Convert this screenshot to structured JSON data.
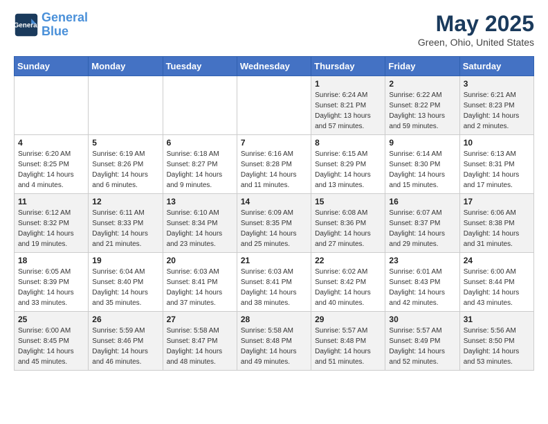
{
  "header": {
    "logo_line1": "General",
    "logo_line2": "Blue",
    "main_title": "May 2025",
    "subtitle": "Green, Ohio, United States"
  },
  "days_of_week": [
    "Sunday",
    "Monday",
    "Tuesday",
    "Wednesday",
    "Thursday",
    "Friday",
    "Saturday"
  ],
  "weeks": [
    [
      {
        "num": "",
        "sunrise": "",
        "sunset": "",
        "daylight": ""
      },
      {
        "num": "",
        "sunrise": "",
        "sunset": "",
        "daylight": ""
      },
      {
        "num": "",
        "sunrise": "",
        "sunset": "",
        "daylight": ""
      },
      {
        "num": "",
        "sunrise": "",
        "sunset": "",
        "daylight": ""
      },
      {
        "num": "1",
        "sunrise": "Sunrise: 6:24 AM",
        "sunset": "Sunset: 8:21 PM",
        "daylight": "Daylight: 13 hours and 57 minutes."
      },
      {
        "num": "2",
        "sunrise": "Sunrise: 6:22 AM",
        "sunset": "Sunset: 8:22 PM",
        "daylight": "Daylight: 13 hours and 59 minutes."
      },
      {
        "num": "3",
        "sunrise": "Sunrise: 6:21 AM",
        "sunset": "Sunset: 8:23 PM",
        "daylight": "Daylight: 14 hours and 2 minutes."
      }
    ],
    [
      {
        "num": "4",
        "sunrise": "Sunrise: 6:20 AM",
        "sunset": "Sunset: 8:25 PM",
        "daylight": "Daylight: 14 hours and 4 minutes."
      },
      {
        "num": "5",
        "sunrise": "Sunrise: 6:19 AM",
        "sunset": "Sunset: 8:26 PM",
        "daylight": "Daylight: 14 hours and 6 minutes."
      },
      {
        "num": "6",
        "sunrise": "Sunrise: 6:18 AM",
        "sunset": "Sunset: 8:27 PM",
        "daylight": "Daylight: 14 hours and 9 minutes."
      },
      {
        "num": "7",
        "sunrise": "Sunrise: 6:16 AM",
        "sunset": "Sunset: 8:28 PM",
        "daylight": "Daylight: 14 hours and 11 minutes."
      },
      {
        "num": "8",
        "sunrise": "Sunrise: 6:15 AM",
        "sunset": "Sunset: 8:29 PM",
        "daylight": "Daylight: 14 hours and 13 minutes."
      },
      {
        "num": "9",
        "sunrise": "Sunrise: 6:14 AM",
        "sunset": "Sunset: 8:30 PM",
        "daylight": "Daylight: 14 hours and 15 minutes."
      },
      {
        "num": "10",
        "sunrise": "Sunrise: 6:13 AM",
        "sunset": "Sunset: 8:31 PM",
        "daylight": "Daylight: 14 hours and 17 minutes."
      }
    ],
    [
      {
        "num": "11",
        "sunrise": "Sunrise: 6:12 AM",
        "sunset": "Sunset: 8:32 PM",
        "daylight": "Daylight: 14 hours and 19 minutes."
      },
      {
        "num": "12",
        "sunrise": "Sunrise: 6:11 AM",
        "sunset": "Sunset: 8:33 PM",
        "daylight": "Daylight: 14 hours and 21 minutes."
      },
      {
        "num": "13",
        "sunrise": "Sunrise: 6:10 AM",
        "sunset": "Sunset: 8:34 PM",
        "daylight": "Daylight: 14 hours and 23 minutes."
      },
      {
        "num": "14",
        "sunrise": "Sunrise: 6:09 AM",
        "sunset": "Sunset: 8:35 PM",
        "daylight": "Daylight: 14 hours and 25 minutes."
      },
      {
        "num": "15",
        "sunrise": "Sunrise: 6:08 AM",
        "sunset": "Sunset: 8:36 PM",
        "daylight": "Daylight: 14 hours and 27 minutes."
      },
      {
        "num": "16",
        "sunrise": "Sunrise: 6:07 AM",
        "sunset": "Sunset: 8:37 PM",
        "daylight": "Daylight: 14 hours and 29 minutes."
      },
      {
        "num": "17",
        "sunrise": "Sunrise: 6:06 AM",
        "sunset": "Sunset: 8:38 PM",
        "daylight": "Daylight: 14 hours and 31 minutes."
      }
    ],
    [
      {
        "num": "18",
        "sunrise": "Sunrise: 6:05 AM",
        "sunset": "Sunset: 8:39 PM",
        "daylight": "Daylight: 14 hours and 33 minutes."
      },
      {
        "num": "19",
        "sunrise": "Sunrise: 6:04 AM",
        "sunset": "Sunset: 8:40 PM",
        "daylight": "Daylight: 14 hours and 35 minutes."
      },
      {
        "num": "20",
        "sunrise": "Sunrise: 6:03 AM",
        "sunset": "Sunset: 8:41 PM",
        "daylight": "Daylight: 14 hours and 37 minutes."
      },
      {
        "num": "21",
        "sunrise": "Sunrise: 6:03 AM",
        "sunset": "Sunset: 8:41 PM",
        "daylight": "Daylight: 14 hours and 38 minutes."
      },
      {
        "num": "22",
        "sunrise": "Sunrise: 6:02 AM",
        "sunset": "Sunset: 8:42 PM",
        "daylight": "Daylight: 14 hours and 40 minutes."
      },
      {
        "num": "23",
        "sunrise": "Sunrise: 6:01 AM",
        "sunset": "Sunset: 8:43 PM",
        "daylight": "Daylight: 14 hours and 42 minutes."
      },
      {
        "num": "24",
        "sunrise": "Sunrise: 6:00 AM",
        "sunset": "Sunset: 8:44 PM",
        "daylight": "Daylight: 14 hours and 43 minutes."
      }
    ],
    [
      {
        "num": "25",
        "sunrise": "Sunrise: 6:00 AM",
        "sunset": "Sunset: 8:45 PM",
        "daylight": "Daylight: 14 hours and 45 minutes."
      },
      {
        "num": "26",
        "sunrise": "Sunrise: 5:59 AM",
        "sunset": "Sunset: 8:46 PM",
        "daylight": "Daylight: 14 hours and 46 minutes."
      },
      {
        "num": "27",
        "sunrise": "Sunrise: 5:58 AM",
        "sunset": "Sunset: 8:47 PM",
        "daylight": "Daylight: 14 hours and 48 minutes."
      },
      {
        "num": "28",
        "sunrise": "Sunrise: 5:58 AM",
        "sunset": "Sunset: 8:48 PM",
        "daylight": "Daylight: 14 hours and 49 minutes."
      },
      {
        "num": "29",
        "sunrise": "Sunrise: 5:57 AM",
        "sunset": "Sunset: 8:48 PM",
        "daylight": "Daylight: 14 hours and 51 minutes."
      },
      {
        "num": "30",
        "sunrise": "Sunrise: 5:57 AM",
        "sunset": "Sunset: 8:49 PM",
        "daylight": "Daylight: 14 hours and 52 minutes."
      },
      {
        "num": "31",
        "sunrise": "Sunrise: 5:56 AM",
        "sunset": "Sunset: 8:50 PM",
        "daylight": "Daylight: 14 hours and 53 minutes."
      }
    ]
  ]
}
